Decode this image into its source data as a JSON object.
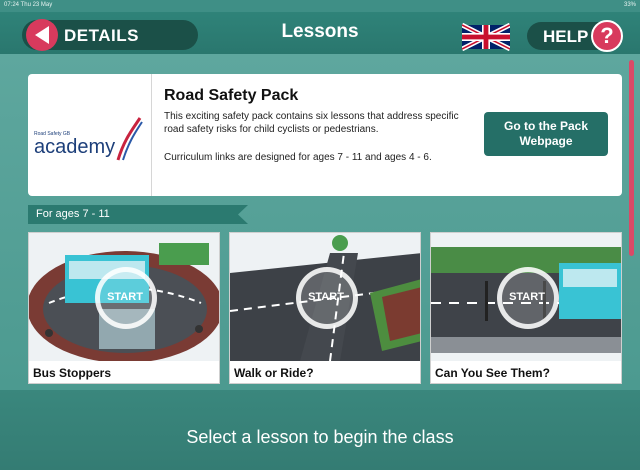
{
  "status_bar": {
    "time_date": "07:24  Thu 23 May",
    "battery": "33%"
  },
  "header": {
    "back_label": "DETAILS",
    "title": "Lessons",
    "help_label": "HELP",
    "help_symbol": "?",
    "language_flag": "uk-flag-icon"
  },
  "pack": {
    "logo_small": "Road Safety GB",
    "logo_main": "academy",
    "title": "Road Safety Pack",
    "description": "This exciting safety pack contains six lessons that address specific road safety risks for child cyclists or pedestrians.",
    "curriculum": "Curriculum links are designed for ages 7 - 11 and ages 4 - 6.",
    "button_label": "Go to the Pack Webpage"
  },
  "age_group": {
    "label": "For ages 7 - 11"
  },
  "lessons": [
    {
      "name": "Bus Stoppers",
      "start_label": "START"
    },
    {
      "name": "Walk or Ride?",
      "start_label": "START"
    },
    {
      "name": "Can You See Them?",
      "start_label": "START"
    }
  ],
  "footer": {
    "text": "Select a lesson to begin the class"
  },
  "colors": {
    "accent_red": "#d83a5d",
    "header_teal": "#2f8379",
    "button_dark": "#1b5048",
    "go_button": "#256f67"
  }
}
